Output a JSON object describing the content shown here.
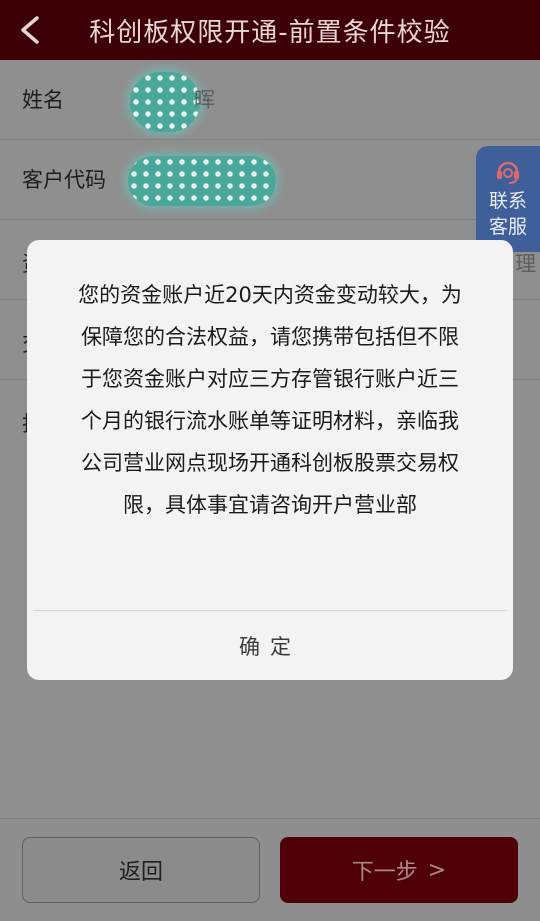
{
  "header": {
    "title": "科创板权限开通-前置条件校验"
  },
  "form": {
    "name_label": "姓名",
    "name_value_tail": "晖",
    "customer_code_label": "客户代码",
    "row3_label": "资",
    "row3_right": "理",
    "row4_label": "交",
    "row5_label": "投"
  },
  "service": {
    "line1": "联系",
    "line2": "客服"
  },
  "dialog": {
    "message": "您的资金账户近20天内资金变动较大，为保障您的合法权益，请您携带包括但不限于您资金账户对应三方存管银行账户近三个月的银行流水账单等证明材料，亲临我公司营业网点现场开通科创板股票交易权限，具体事宜请咨询开户营业部",
    "confirm_label": "确定"
  },
  "footer": {
    "back_label": "返回",
    "next_label": "下一步",
    "next_arrow": ">"
  },
  "colors": {
    "header_bg": "#3d0006",
    "next_button_bg": "#4f0008",
    "service_bg": "#3f5f9b"
  }
}
